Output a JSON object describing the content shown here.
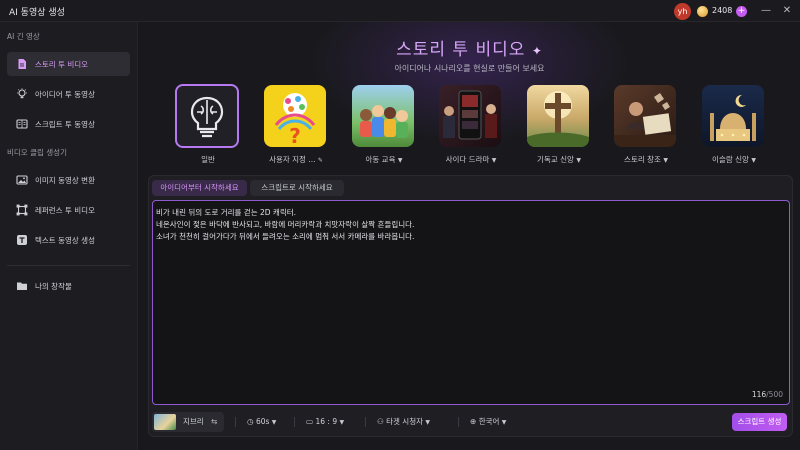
{
  "app": {
    "title": "AI 동영상 생성"
  },
  "account": {
    "avatar_initials": "yh",
    "credits": "2408",
    "add_label": "+"
  },
  "window": {
    "minimize": "—",
    "close": "✕"
  },
  "sidebar": {
    "section1": "AI 긴 영상",
    "section2": "비디오 클립 생성기",
    "items": [
      {
        "label": "스토리 투 비디오",
        "icon": "document-icon",
        "active": true
      },
      {
        "label": "아이디어 투 동영상",
        "icon": "lightbulb-icon"
      },
      {
        "label": "스크립트 투 동영상",
        "icon": "script-icon"
      },
      {
        "label": "이미지 동영상 변환",
        "icon": "image-icon"
      },
      {
        "label": "레퍼런스 투 비디오",
        "icon": "reference-icon"
      },
      {
        "label": "텍스트 동영상 생성",
        "icon": "text-icon"
      },
      {
        "label": "나의 창작물",
        "icon": "folder-icon"
      }
    ]
  },
  "hero": {
    "title": "스토리 투 비디오",
    "subtitle": "아이디어나 시나리오를 현실로 만들어 보세요"
  },
  "categories": [
    {
      "label": "일반",
      "icon": "brain-bulb-icon",
      "caret": ""
    },
    {
      "label": "사용자 지정 ...",
      "icon": "custom-question-icon",
      "caret": "✎"
    },
    {
      "label": "아동 교육",
      "icon": "children-icon",
      "caret": "▼"
    },
    {
      "label": "사이다 드라마",
      "icon": "drama-icon",
      "caret": "▼"
    },
    {
      "label": "기독교 신앙",
      "icon": "cross-icon",
      "caret": "▼"
    },
    {
      "label": "스토리 창조",
      "icon": "story-icon",
      "caret": "▼"
    },
    {
      "label": "이슬람 신앙",
      "icon": "mosque-icon",
      "caret": "▼"
    }
  ],
  "editor": {
    "tabs": [
      "아이디어부터 시작하세요",
      "스크립트로 시작하세요"
    ],
    "lines": [
      "비가 내린 뒤의 도로 거리를 걷는 2D 캐릭터.",
      "네온사인이 젖은 바닥에 반사되고, 바람에 머리카락과 치맛자락이 살짝 흔들립니다.",
      "소녀가 천천히 걸어가다가 뒤에서 들려오는 소리에 멈춰 서서 카메라를 바라봅니다."
    ],
    "count": "116",
    "max": "/500"
  },
  "toolbar": {
    "voice": "지브리",
    "duration": "60s",
    "ratio": "16 : 9",
    "audience": "타겟 시청자",
    "language": "한국어",
    "generate": "스크립트 생성"
  },
  "colors": {
    "accent": "#c05cf2",
    "background": "#161619"
  }
}
